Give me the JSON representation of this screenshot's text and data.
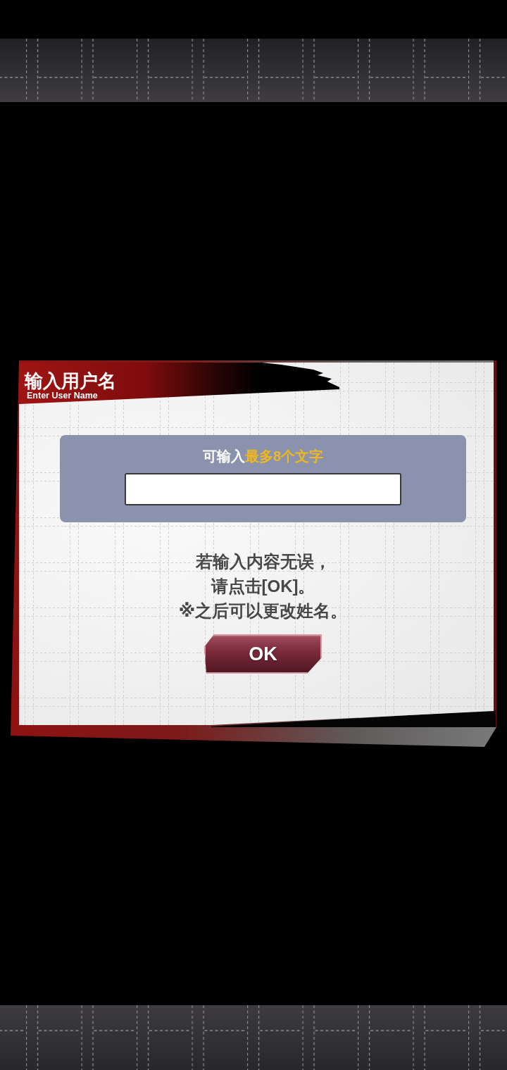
{
  "dialog": {
    "title": "输入用户名",
    "subtitle": "Enter User Name",
    "hint": [
      {
        "text": "可输入",
        "highlight": false
      },
      {
        "text": "最多8个文字",
        "highlight": true
      }
    ],
    "message": [
      "若输入内容无误，",
      "请点击[OK]。",
      "※之后可以更改姓名。"
    ],
    "ok_button": {
      "label": "OK"
    }
  }
}
